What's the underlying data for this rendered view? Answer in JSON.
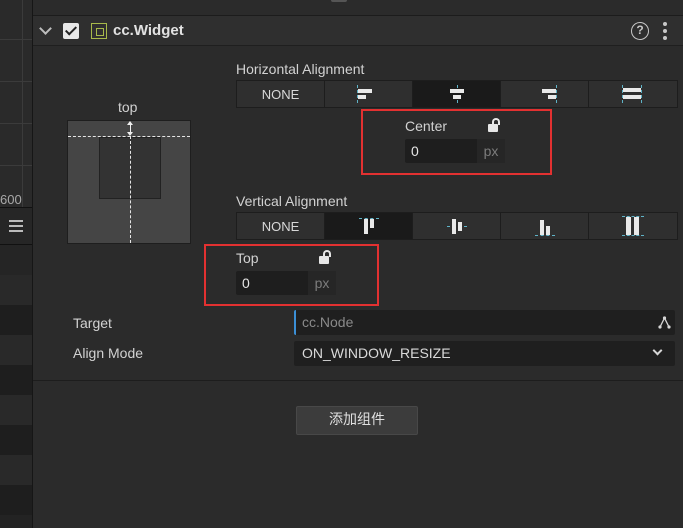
{
  "scene": {
    "coord_label": "600"
  },
  "component": {
    "title": "cc.Widget",
    "help_glyph": "?"
  },
  "preview": {
    "label": "top"
  },
  "horizontal": {
    "title": "Horizontal Alignment",
    "options": [
      "NONE",
      "left",
      "center",
      "right",
      "stretch"
    ],
    "selected": "center",
    "field_label": "Center",
    "value": "0",
    "unit": "px"
  },
  "vertical": {
    "title": "Vertical Alignment",
    "options": [
      "NONE",
      "top",
      "middle",
      "bottom",
      "stretch"
    ],
    "selected": "top",
    "field_label": "Top",
    "value": "0",
    "unit": "px"
  },
  "target": {
    "label": "Target",
    "placeholder": "cc.Node"
  },
  "align_mode": {
    "label": "Align Mode",
    "value": "ON_WINDOW_RESIZE"
  },
  "add_component": {
    "label": "添加组件"
  },
  "colors": {
    "highlight": "#e33131",
    "accent_blue": "#3b8fd6",
    "guide_cyan": "#5fb3c7",
    "widget_icon": "#a7b94a"
  }
}
